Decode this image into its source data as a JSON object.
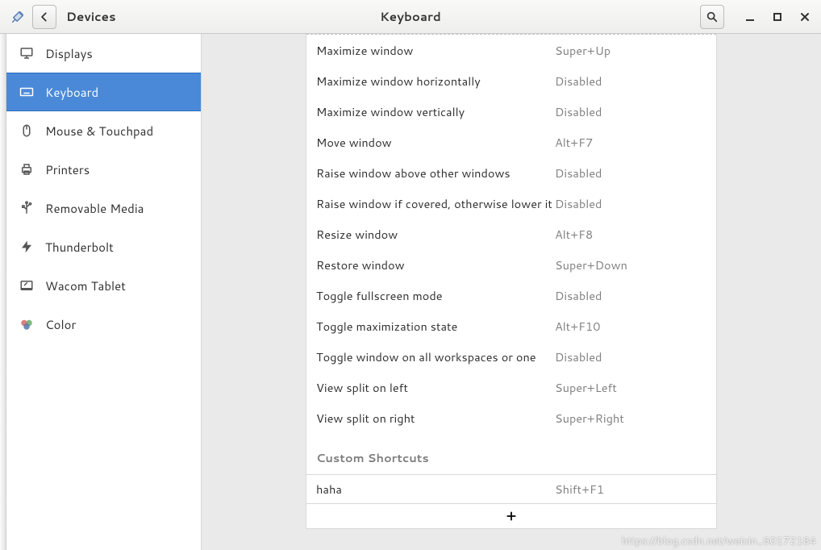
{
  "header": {
    "back_section": "Devices",
    "page_title": "Keyboard"
  },
  "sidebar": {
    "items": [
      {
        "label": "Displays",
        "icon": "monitor-icon"
      },
      {
        "label": "Keyboard",
        "icon": "keyboard-icon",
        "selected": true
      },
      {
        "label": "Mouse & Touchpad",
        "icon": "mouse-icon"
      },
      {
        "label": "Printers",
        "icon": "printer-icon"
      },
      {
        "label": "Removable Media",
        "icon": "usb-icon"
      },
      {
        "label": "Thunderbolt",
        "icon": "thunderbolt-icon"
      },
      {
        "label": "Wacom Tablet",
        "icon": "tablet-icon"
      },
      {
        "label": "Color",
        "icon": "color-icon"
      }
    ]
  },
  "shortcuts": [
    {
      "name": "Maximize window",
      "key": "Super+Up"
    },
    {
      "name": "Maximize window horizontally",
      "key": "Disabled"
    },
    {
      "name": "Maximize window vertically",
      "key": "Disabled"
    },
    {
      "name": "Move window",
      "key": "Alt+F7"
    },
    {
      "name": "Raise window above other windows",
      "key": "Disabled"
    },
    {
      "name": "Raise window if covered, otherwise lower it",
      "key": "Disabled"
    },
    {
      "name": "Resize window",
      "key": "Alt+F8"
    },
    {
      "name": "Restore window",
      "key": "Super+Down"
    },
    {
      "name": "Toggle fullscreen mode",
      "key": "Disabled"
    },
    {
      "name": "Toggle maximization state",
      "key": "Alt+F10"
    },
    {
      "name": "Toggle window on all workspaces or one",
      "key": "Disabled"
    },
    {
      "name": "View split on left",
      "key": "Super+Left"
    },
    {
      "name": "View split on right",
      "key": "Super+Right"
    }
  ],
  "custom_section": {
    "title": "Custom Shortcuts",
    "items": [
      {
        "name": "haha",
        "key": "Shift+F1"
      }
    ]
  },
  "watermark": "https://blog.csdn.net/weixin_60172184"
}
